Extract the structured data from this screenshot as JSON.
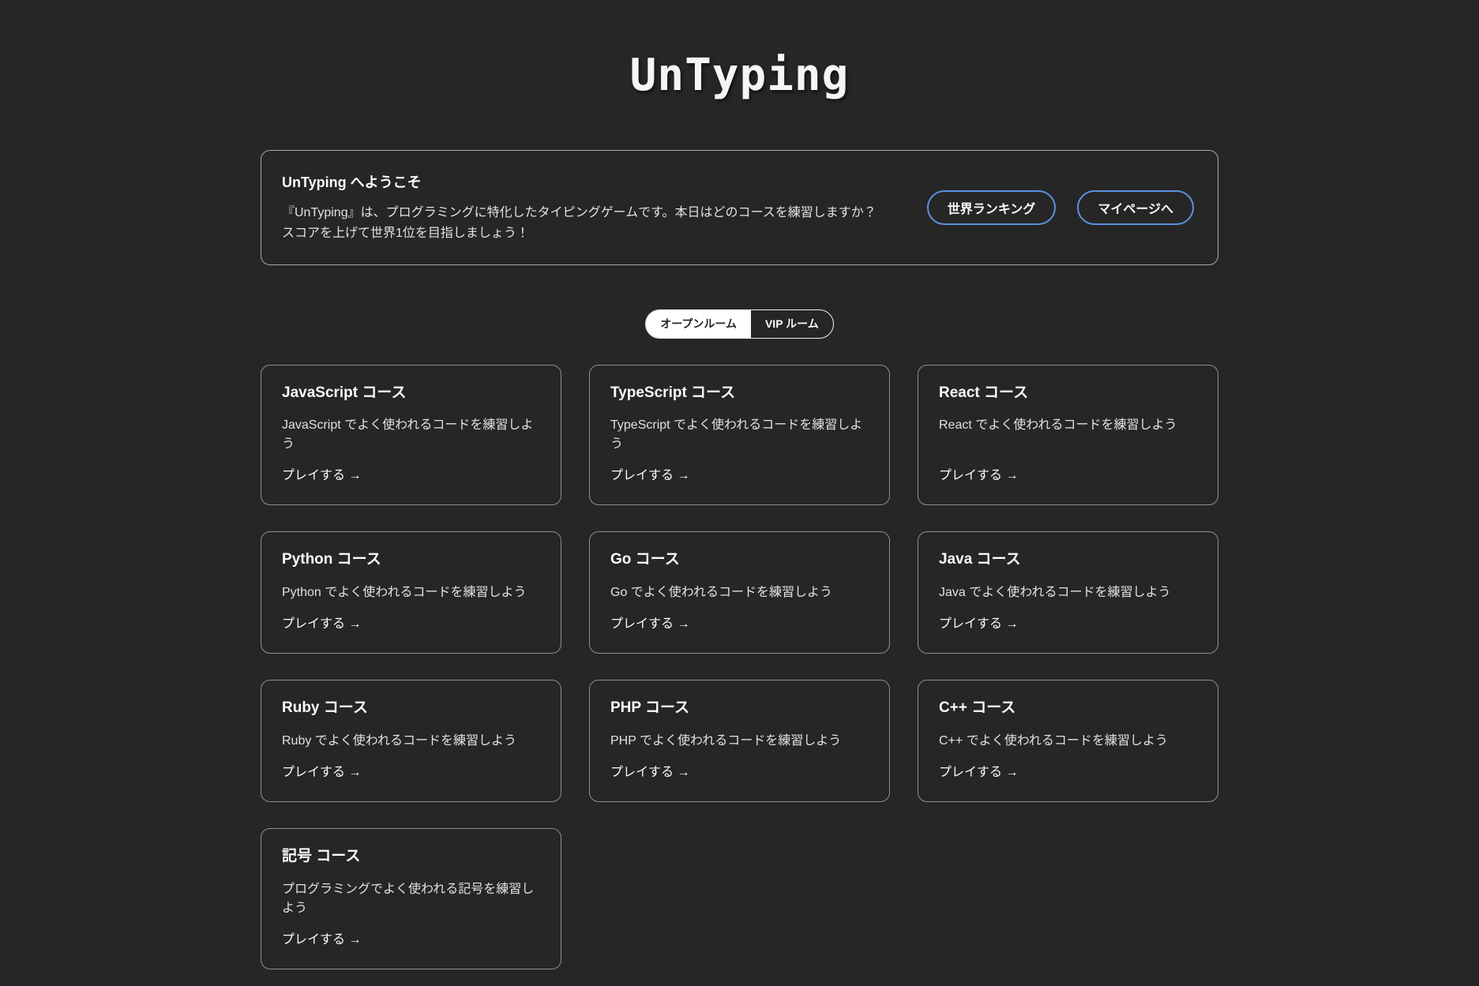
{
  "app": {
    "title": "UnTyping"
  },
  "welcome": {
    "heading": "UnTyping へようこそ",
    "body": "『UnTyping』は、プログラミングに特化したタイピングゲームです。本日はどのコースを練習しますか？\nスコアを上げて世界1位を目指しましょう！",
    "ranking_button": "世界ランキング",
    "mypage_button": "マイページへ"
  },
  "room_tabs": {
    "open_label": "オープンルーム",
    "vip_label": "VIP ルーム",
    "active": "オープンルーム"
  },
  "play_label": "プレイする →",
  "courses": [
    {
      "title": "JavaScript コース",
      "description": "JavaScript でよく使われるコードを練習しよう"
    },
    {
      "title": "TypeScript コース",
      "description": "TypeScript でよく使われるコードを練習しよう"
    },
    {
      "title": "React コース",
      "description": "React でよく使われるコードを練習しよう"
    },
    {
      "title": "Python コース",
      "description": "Python でよく使われるコードを練習しよう"
    },
    {
      "title": "Go コース",
      "description": "Go でよく使われるコードを練習しよう"
    },
    {
      "title": "Java コース",
      "description": "Java でよく使われるコードを練習しよう"
    },
    {
      "title": "Ruby コース",
      "description": "Ruby でよく使われるコードを練習しよう"
    },
    {
      "title": "PHP コース",
      "description": "PHP でよく使われるコードを練習しよう"
    },
    {
      "title": "C++ コース",
      "description": "C++ でよく使われるコードを練習しよう"
    },
    {
      "title": "記号 コース",
      "description": "プログラミングでよく使われる記号を練習しよう"
    }
  ],
  "colors": {
    "background": "#262626",
    "accent_blue": "#5a91e0",
    "card_border": "#8f8f8f",
    "welcome_border": "#a8a8a8",
    "text_primary": "#fafafa",
    "text_secondary": "#e2e2e2",
    "tab_active_bg": "#ffffff"
  }
}
